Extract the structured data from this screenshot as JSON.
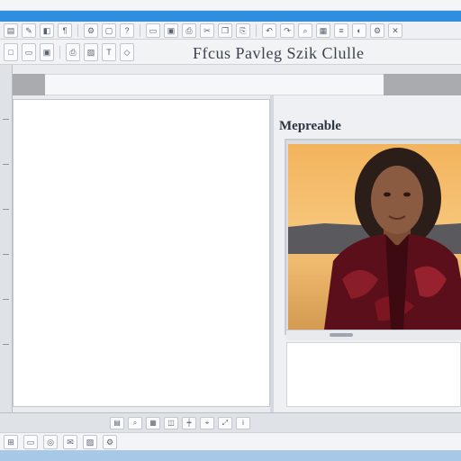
{
  "colors": {
    "accent": "#2f8fde"
  },
  "toolbar": {
    "title": "Ffcus Pavleg Szik Clulle",
    "buttons_row1": [
      "file-icon",
      "edit-icon",
      "view-icon",
      "format-icon",
      "tools-icon",
      "window-icon",
      "help-icon",
      "open-icon",
      "save-icon",
      "print-icon",
      "cut-icon",
      "copy-icon",
      "paste-icon",
      "undo-icon",
      "redo-icon",
      "zoom-icon"
    ],
    "buttons_row2": [
      "new-icon",
      "open-folder-icon",
      "save-icon",
      "print-icon",
      "image-icon",
      "text-icon",
      "shape-icon"
    ]
  },
  "preview": {
    "title": "Mepreable"
  },
  "statusbar": {
    "items": [
      "page-icon",
      "zoom-icon",
      "grid-icon",
      "layer-icon",
      "ruler-icon",
      "snap-icon",
      "fit-icon",
      "info-icon"
    ]
  },
  "taskbar": {
    "items": [
      "start-icon",
      "folder-icon",
      "browser-icon",
      "mail-icon",
      "photo-icon",
      "settings-icon"
    ]
  }
}
